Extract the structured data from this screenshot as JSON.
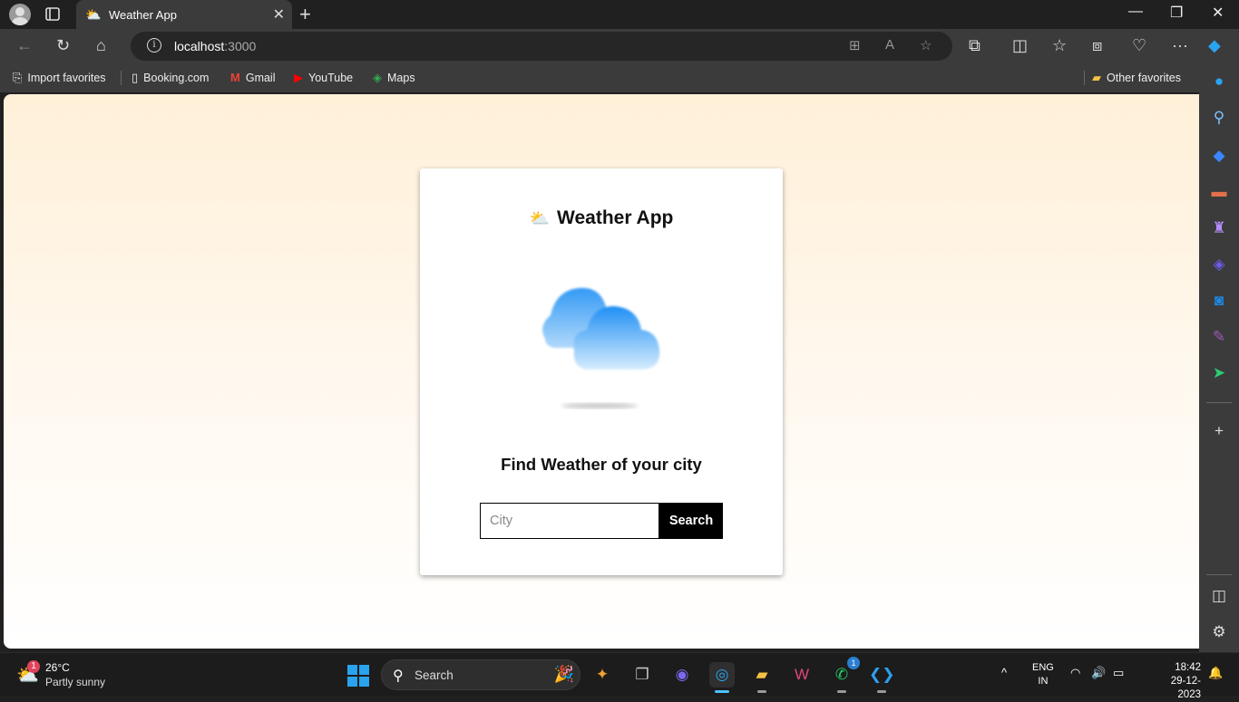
{
  "browser": {
    "tab_title": "Weather App",
    "tab_favicon": "⛅",
    "url_host": "localhost",
    "url_port": ":3000"
  },
  "bookmarks": [
    {
      "label": "Import favorites",
      "icon": "import-icon"
    },
    {
      "label": "Booking.com",
      "icon": "page-icon"
    },
    {
      "label": "Gmail",
      "icon": "gmail-icon"
    },
    {
      "label": "YouTube",
      "icon": "youtube-icon"
    },
    {
      "label": "Maps",
      "icon": "maps-icon"
    }
  ],
  "other_favorites": "Other favorites",
  "app": {
    "header_emoji": "⛅",
    "header_title": "Weather App",
    "find_title": "Find Weather of your city",
    "city_placeholder": "City",
    "city_value": "",
    "search_label": "Search"
  },
  "taskbar": {
    "weather_temp": "26°C",
    "weather_condition": "Partly sunny",
    "weather_badge": "1",
    "search_label": "Search",
    "whatsapp_badge": "1",
    "lang_line1": "ENG",
    "lang_line2": "IN",
    "time": "18:42",
    "date": "29-12-2023"
  },
  "colors": {
    "accent": "#2aa3ef",
    "page_gradient_top": "#fff0d8",
    "button_bg": "#000000"
  }
}
